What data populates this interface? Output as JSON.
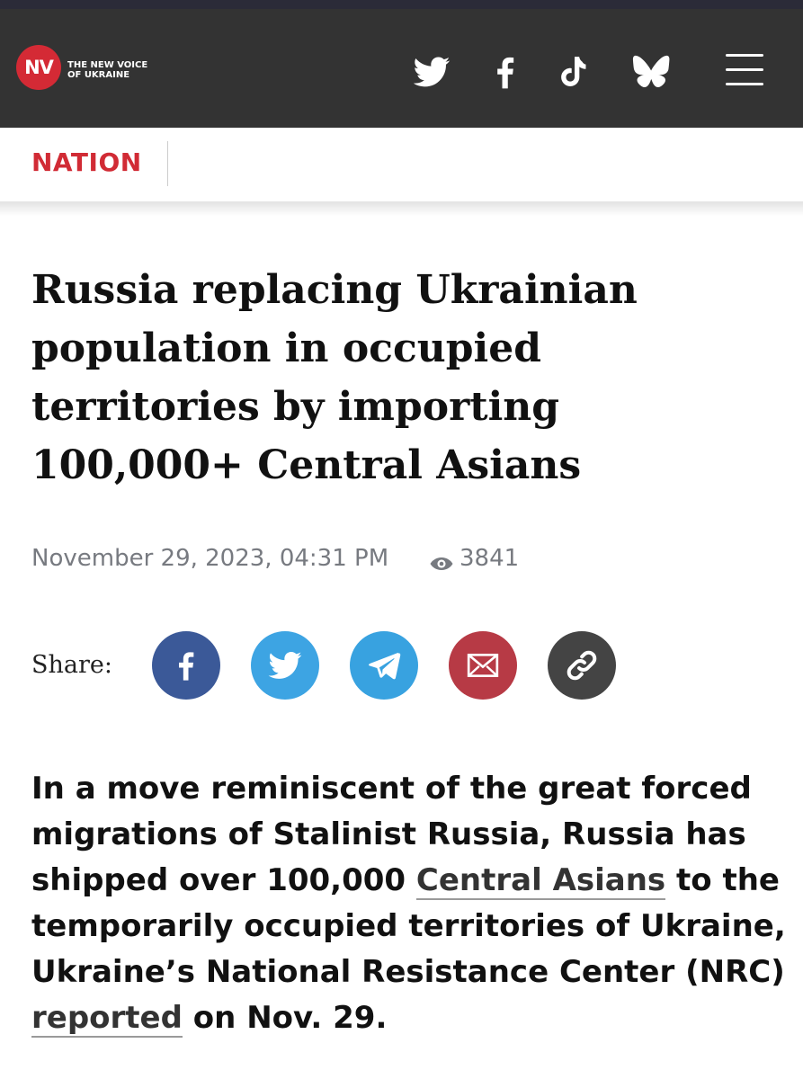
{
  "header": {
    "logo_mark": "NV",
    "logo_line1": "THE NEW VOICE",
    "logo_line2": "OF UKRAINE",
    "icons": [
      "twitter-icon",
      "facebook-icon",
      "tiktok-icon",
      "bluesky-icon",
      "menu-icon"
    ]
  },
  "section": {
    "label": "NATION"
  },
  "article": {
    "title": "Russia replacing Ukrainian population in occupied territories by importing 100,000+ Central Asians",
    "date": "November 29, 2023, 04:31 PM",
    "views": "3841",
    "share_label": "Share:",
    "share_buttons": [
      {
        "icon": "facebook-icon",
        "color": "#3b5998"
      },
      {
        "icon": "twitter-icon",
        "color": "#3da4e3"
      },
      {
        "icon": "telegram-icon",
        "color": "#38a2e0"
      },
      {
        "icon": "email-icon",
        "color": "#b73a45"
      },
      {
        "icon": "link-icon",
        "color": "#444444"
      }
    ],
    "lead": {
      "part1": "In a move reminiscent of the great forced migrations of Stalinist Russia, Russia has shipped over 100,000 ",
      "link1": "Central Asians",
      "part2": " to the temporarily occupied territories of Ukraine, Ukraine’s National Resistance Center (NRC) ",
      "link2": "reported",
      "part3": " on Nov. 29."
    }
  },
  "colors": {
    "header_bg": "#333333",
    "brand_red": "#d42a35",
    "section_red": "#d12b35",
    "meta_gray": "#777a80"
  }
}
